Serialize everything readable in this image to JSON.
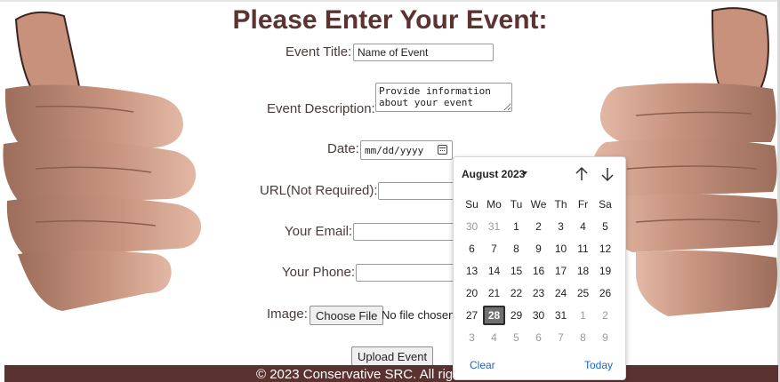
{
  "page": {
    "title": "Please Enter Your Event:"
  },
  "form": {
    "event_title": {
      "label": "Event Title:",
      "placeholder": "Name of Event"
    },
    "event_description": {
      "label": "Event Description:",
      "placeholder": "Provide information about your event"
    },
    "date": {
      "label": "Date:",
      "placeholder": "mm/dd/yyyy"
    },
    "url": {
      "label": "URL(Not Required):",
      "value": ""
    },
    "email": {
      "label": "Your Email:",
      "value": ""
    },
    "phone": {
      "label": "Your Phone:",
      "value": ""
    },
    "image": {
      "label": "Image:",
      "button": "Choose File",
      "status": "No file chosen"
    },
    "submit": "Upload Event"
  },
  "footer": {
    "text": "© 2023 Conservative SRC. All righ"
  },
  "datepicker": {
    "month_label": "August 2023",
    "weekdays": [
      "Su",
      "Mo",
      "Tu",
      "We",
      "Th",
      "Fr",
      "Sa"
    ],
    "weeks": [
      [
        "30",
        "31",
        "1",
        "2",
        "3",
        "4",
        "5"
      ],
      [
        "6",
        "7",
        "8",
        "9",
        "10",
        "11",
        "12"
      ],
      [
        "13",
        "14",
        "15",
        "16",
        "17",
        "18",
        "19"
      ],
      [
        "20",
        "21",
        "22",
        "23",
        "24",
        "25",
        "26"
      ],
      [
        "27",
        "28",
        "29",
        "30",
        "31",
        "1",
        "2"
      ],
      [
        "3",
        "4",
        "5",
        "6",
        "7",
        "8",
        "9"
      ]
    ],
    "selected_day": "28",
    "clear_label": "Clear",
    "today_label": "Today",
    "link_color": "#1a66c8"
  },
  "colors": {
    "title": "#5b3431",
    "footer_bg": "#5a3230"
  },
  "icons": {
    "calendar": "calendar-icon",
    "prev_month": "arrow-up-icon",
    "next_month": "arrow-down-icon",
    "month_dropdown": "caret-down-icon"
  }
}
